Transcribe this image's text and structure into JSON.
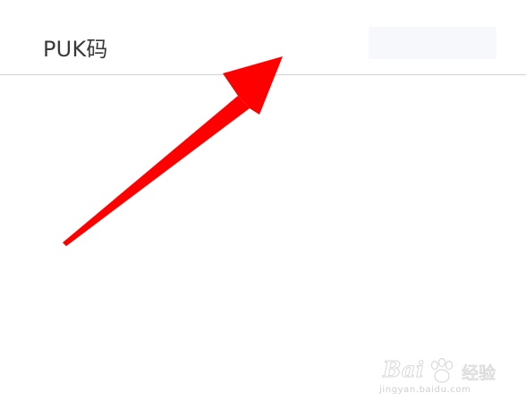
{
  "puk_form": {
    "label": "PUK码",
    "input_value": "",
    "input_placeholder": "",
    "input_background": "#f7f8fc",
    "divider_color": "#d2d2d2"
  },
  "annotation": {
    "type": "arrow",
    "color": "#ff0000",
    "points_to": "puk-input"
  },
  "watermark": {
    "brand": "Bai",
    "brand_cn": "经验",
    "url": "jingyan.baidu.com"
  }
}
